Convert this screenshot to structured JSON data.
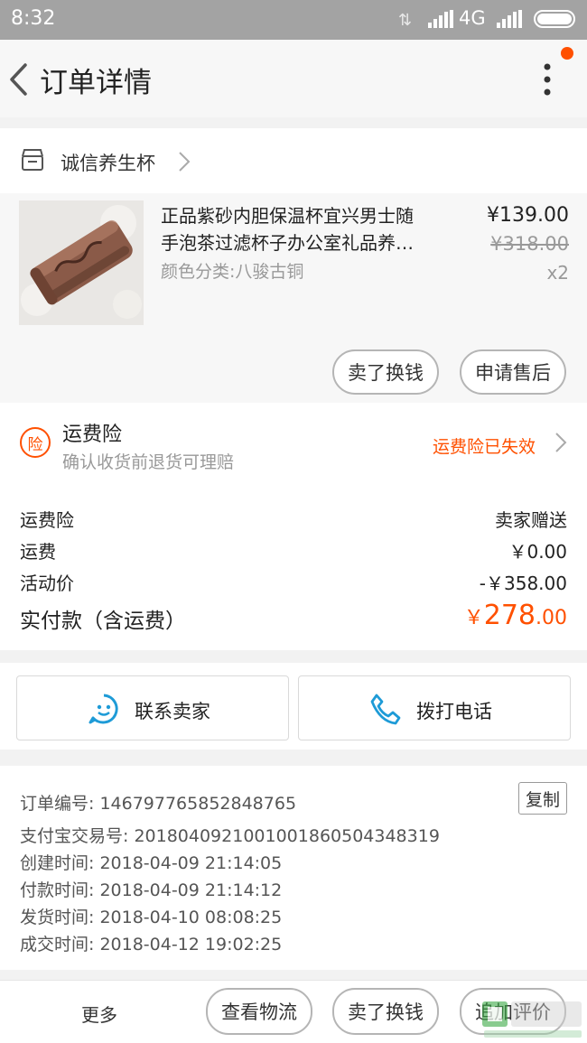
{
  "status_bar": {
    "time": "8:32",
    "network": "4G"
  },
  "header": {
    "title": "订单详情"
  },
  "shop": {
    "name": "诚信养生杯"
  },
  "product": {
    "title_line1": "正品紫砂内胆保温杯宜兴男士随",
    "title_line2": "手泡茶过滤杯子办公室礼品养…",
    "sku": "颜色分类:八骏古铜",
    "price": "¥139.00",
    "original_price": "¥318.00",
    "quantity": "x2",
    "sell_button": "卖了换钱",
    "after_sale_button": "申请售后"
  },
  "insurance": {
    "badge": "险",
    "title": "运费险",
    "subtitle": "确认收货前退货可理赔",
    "status": "运费险已失效"
  },
  "fees": [
    {
      "label": "运费险",
      "value": "卖家赠送"
    },
    {
      "label": "运费",
      "value": "￥0.00"
    },
    {
      "label": "活动价",
      "value": "-￥358.00"
    }
  ],
  "total": {
    "label": "实付款（含运费）",
    "currency": "￥",
    "integer": "278",
    "decimal": ".00"
  },
  "contact": {
    "seller": "联系卖家",
    "call": "拨打电话"
  },
  "order_info": {
    "order_no": "订单编号: 146797765852848765",
    "alipay_no": "支付宝交易号: 2018040921001001860504348319",
    "created": "创建时间: 2018-04-09 21:14:05",
    "paid": "付款时间: 2018-04-09 21:14:12",
    "shipped": "发货时间: 2018-04-10 08:08:25",
    "completed": "成交时间: 2018-04-12 19:02:25",
    "copy": "复制"
  },
  "bottom": {
    "more": "更多",
    "logistics": "查看物流",
    "sell": "卖了换钱",
    "review": "追加评价"
  },
  "colors": {
    "accent": "#ff5000",
    "status_bar": "#a3a3a3",
    "contact_icon": "#1e9bd7"
  }
}
